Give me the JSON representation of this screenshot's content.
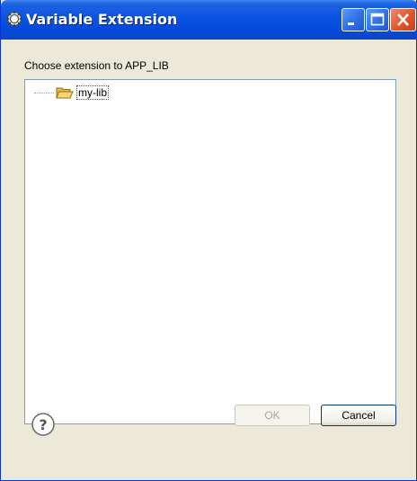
{
  "window": {
    "title": "Variable Extension"
  },
  "titlebar_buttons": [
    "minimize-icon",
    "maximize-icon",
    "close-icon"
  ],
  "dialog": {
    "prompt": "Choose extension to APP_LIB",
    "tree": {
      "nodes": [
        {
          "label": "my-lib",
          "icon": "folder-open-icon",
          "selected": true
        }
      ]
    }
  },
  "buttons": {
    "ok_label": "OK",
    "ok_enabled": false,
    "cancel_label": "Cancel",
    "help_icon": "help-icon"
  },
  "colors": {
    "titlebar": "#0a54e3",
    "dialog_bg": "#ece9d8",
    "close_button": "#e0552b"
  }
}
